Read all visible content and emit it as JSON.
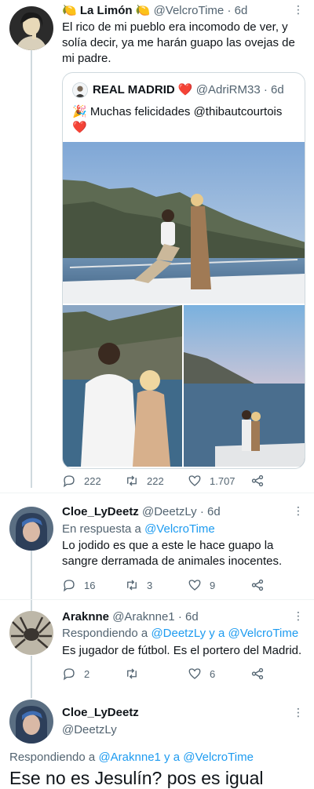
{
  "tweet1": {
    "name": "La Limón",
    "name_emoji": "🍋",
    "handle": "@VelcroTime",
    "time": "· 6d",
    "text": "El rico de mi pueblo era incomodo de ver, y solía decir, ya me harán guapo las ovejas de mi padre.",
    "quote": {
      "name": "REAL MADRID",
      "name_emoji": "❤️",
      "handle": "@AdriRM33",
      "time": "· 6d",
      "text": "🎉 Muchas felicidades @thibautcourtois ❤️"
    },
    "replies": "222",
    "retweets": "222",
    "likes": "1.707"
  },
  "tweet2": {
    "name": "Cloe_LyDeetz",
    "handle": "@DeetzLy",
    "time": "· 6d",
    "reply_prefix": "En respuesta a",
    "reply_to": "@VelcroTime",
    "text": "Lo jodido es que a este le hace guapo la sangre derramada de animales inocentes.",
    "replies": "16",
    "retweets": "3",
    "likes": "9"
  },
  "tweet3": {
    "name": "Araknne",
    "handle": "@Araknne1",
    "time": "· 6d",
    "reply_prefix": "Respondiendo a",
    "reply_to": "@DeetzLy y a @VelcroTime",
    "text": "Es jugador de fútbol. Es el portero del Madrid.",
    "replies": "2",
    "retweets": "",
    "likes": "6"
  },
  "tweet4": {
    "name": "Cloe_LyDeetz",
    "handle": "@DeetzLy",
    "reply_prefix": "Respondiendo a",
    "reply_to": "@Araknne1 y a @VelcroTime",
    "text": "Ese no es Jesulín? pos es igual"
  },
  "colors": {
    "accent": "#1d9bf0",
    "muted": "#536471",
    "text": "#0f1419",
    "border": "#cfd9de"
  }
}
